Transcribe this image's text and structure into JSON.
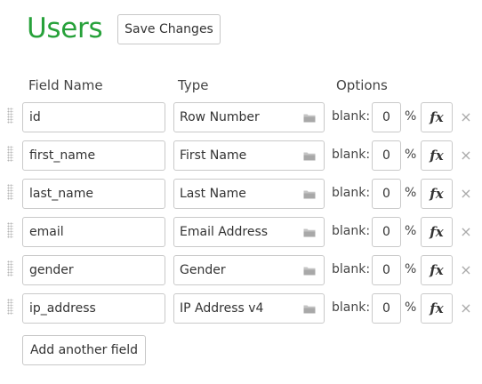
{
  "title": "Users",
  "save_label": "Save Changes",
  "headers": {
    "field_name": "Field Name",
    "type": "Type",
    "options": "Options"
  },
  "blank_label": "blank:",
  "percent_sign": "%",
  "fx_label": "fx",
  "delete_glyph": "×",
  "fields": [
    {
      "name": "id",
      "type": "Row Number",
      "blank": "0"
    },
    {
      "name": "first_name",
      "type": "First Name",
      "blank": "0"
    },
    {
      "name": "last_name",
      "type": "Last Name",
      "blank": "0"
    },
    {
      "name": "email",
      "type": "Email Address",
      "blank": "0"
    },
    {
      "name": "gender",
      "type": "Gender",
      "blank": "0"
    },
    {
      "name": "ip_address",
      "type": "IP Address v4",
      "blank": "0"
    }
  ],
  "add_field_label": "Add another field",
  "colors": {
    "title": "#27a13a",
    "border": "#c9c9c9",
    "delete": "#aaaaaa"
  },
  "icons": {
    "drag": "drag-handle-icon",
    "type_picker": "folder-icon",
    "formula": "fx-icon",
    "delete": "close-icon"
  }
}
